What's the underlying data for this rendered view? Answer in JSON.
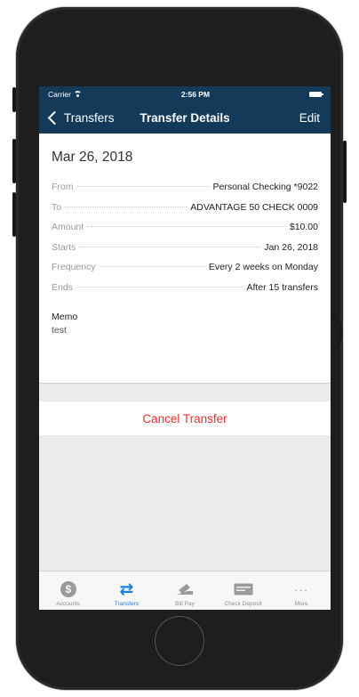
{
  "status": {
    "carrier": "Carrier",
    "time": "2:56 PM"
  },
  "nav": {
    "back_label": "Transfers",
    "title": "Transfer Details",
    "edit_label": "Edit"
  },
  "details": {
    "date": "Mar 26, 2018",
    "rows": [
      {
        "label": "From",
        "value": "Personal Checking *9022"
      },
      {
        "label": "To",
        "value": "ADVANTAGE 50 CHECK 0009"
      },
      {
        "label": "Amount",
        "value": "$10.00"
      },
      {
        "label": "Starts",
        "value": "Jan 26, 2018"
      },
      {
        "label": "Frequency",
        "value": "Every 2 weeks on Monday"
      },
      {
        "label": "Ends",
        "value": "After 15 transfers"
      }
    ],
    "memo_label": "Memo",
    "memo_value": "test"
  },
  "actions": {
    "cancel_label": "Cancel Transfer"
  },
  "tabs": [
    {
      "label": "Accounts",
      "icon": "dollar-icon"
    },
    {
      "label": "Transfers",
      "icon": "transfer-icon"
    },
    {
      "label": "Bill Pay",
      "icon": "bill-pay-icon"
    },
    {
      "label": "Check Deposit",
      "icon": "check-deposit-icon"
    },
    {
      "label": "More",
      "icon": "more-icon"
    }
  ],
  "icons": {
    "dollar": "$",
    "transfer": "⇄",
    "more": "···"
  },
  "colors": {
    "nav_background": "#133a59",
    "accent_blue": "#1a7fe0",
    "cancel_red": "#e8302b"
  }
}
